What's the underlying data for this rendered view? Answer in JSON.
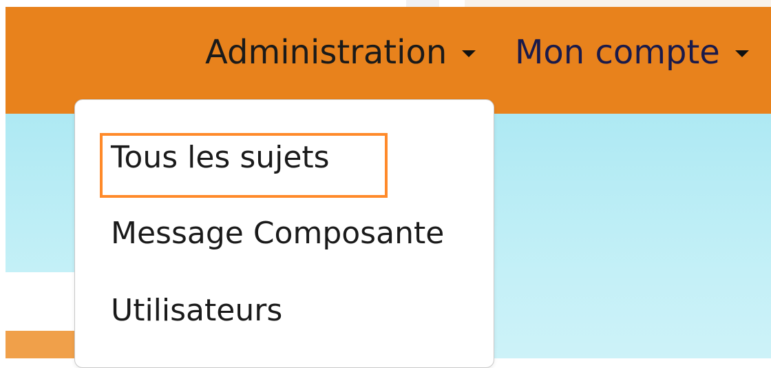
{
  "navbar": {
    "administration_label": "Administration",
    "account_label": "Mon compte"
  },
  "dropdown": {
    "items": [
      {
        "label": "Tous les sujets",
        "highlighted": true
      },
      {
        "label": "Message Composante",
        "highlighted": false
      },
      {
        "label": "Utilisateurs",
        "highlighted": false
      }
    ]
  },
  "colors": {
    "navbar_bg": "#e8821c",
    "highlight_border": "#ff8a2a",
    "content_bg": "#aee9f3"
  }
}
